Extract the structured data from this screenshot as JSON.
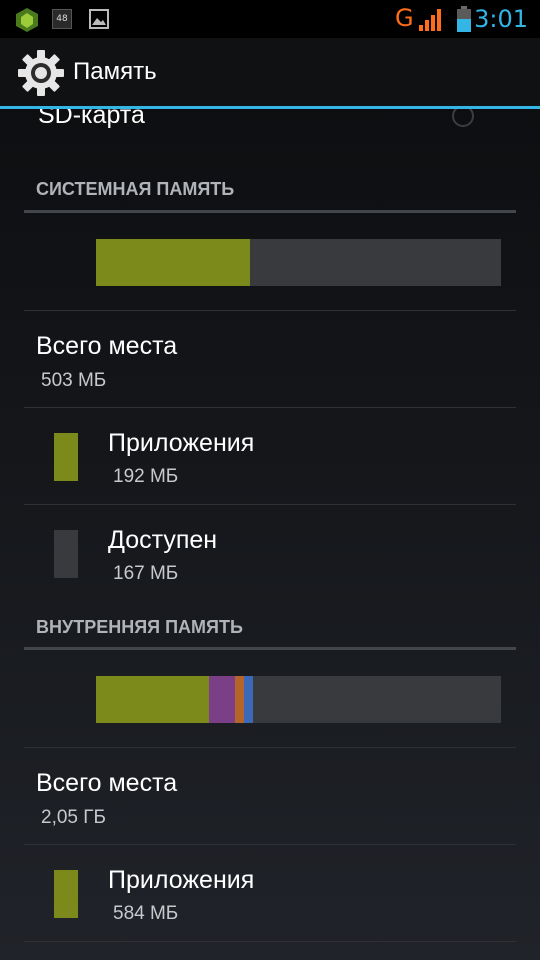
{
  "status_bar": {
    "notification_count": "48",
    "network_type": "G",
    "time": "3:01",
    "icons": [
      "android-bug-icon",
      "notification-48-icon",
      "image-icon",
      "signal-icon",
      "battery-icon"
    ]
  },
  "action_bar": {
    "title": "Память",
    "icon": "gear-icon"
  },
  "sd_card": {
    "label": "SD-карта"
  },
  "system_memory": {
    "header": "СИСТЕМНАЯ ПАМЯТЬ",
    "total_label": "Всего места",
    "total_value": "503 МБ",
    "usage_fractions": {
      "apps": 0.38
    },
    "items": [
      {
        "label": "Приложения",
        "value": "192 МБ",
        "color": "#7b8a1b"
      },
      {
        "label": "Доступен",
        "value": "167 МБ",
        "color": "#383a3d"
      }
    ]
  },
  "internal_memory": {
    "header": "ВНУТРЕННЯЯ ПАМЯТЬ",
    "total_label": "Всего места",
    "total_value": "2,05 ГБ",
    "usage_fractions": {
      "apps": 0.28,
      "media": 0.064,
      "other": 0.022,
      "cache": 0.022
    },
    "items": [
      {
        "label": "Приложения",
        "value": "584 МБ",
        "color": "#7b8a1b"
      }
    ]
  },
  "colors": {
    "accent": "#33b5e5",
    "apps": "#7b8a1b",
    "free": "#383a3d",
    "media": "#7a3f86",
    "other": "#b5652b",
    "cache": "#3c68b8",
    "network_orange": "#ff6d1a"
  }
}
